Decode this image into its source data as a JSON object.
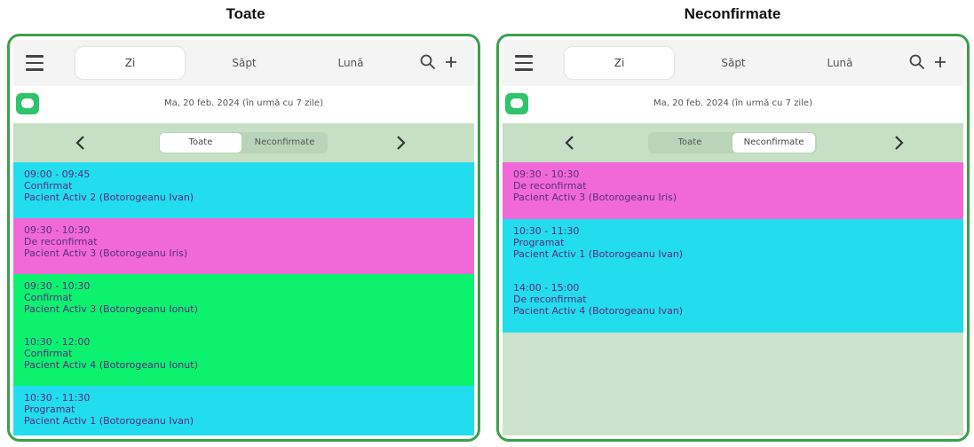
{
  "panels": [
    {
      "caption": "Toate",
      "tabs": {
        "day": "Zi",
        "week": "Săpt",
        "month": "Lună"
      },
      "date": "Ma, 20 feb. 2024 (în urmă cu 7 zile)",
      "filter": {
        "all": "Toate",
        "unconfirmed": "Neconfirmate",
        "selected": "all"
      },
      "appointments": [
        {
          "time": "09:00 - 09:45",
          "status": "Confirmat",
          "patient": "Pacient Activ 2 (Botorogeanu  Ivan)",
          "color": "#22dded"
        },
        {
          "time": "09:30 - 10:30",
          "status": "De reconfirmat",
          "patient": "Pacient Activ 3 (Botorogeanu Iris)",
          "color": "#f169d9"
        },
        {
          "time": "09:30 - 10:30",
          "status": "Confirmat",
          "patient": "Pacient Activ 3 (Botorogeanu Ionut)",
          "color": "#0cf26f"
        },
        {
          "time": "10:30 - 12:00",
          "status": "Confirmat",
          "patient": "Pacient Activ 4 (Botorogeanu Ionut)",
          "color": "#0cf26f"
        },
        {
          "time": "10:30 - 11:30",
          "status": "Programat",
          "patient": "Pacient Activ 1 (Botorogeanu  Ivan)",
          "color": "#22dded"
        }
      ]
    },
    {
      "caption": "Neconfirmate",
      "tabs": {
        "day": "Zi",
        "week": "Săpt",
        "month": "Lună"
      },
      "date": "Ma, 20 feb. 2024 (în urmă cu 7 zile)",
      "filter": {
        "all": "Toate",
        "unconfirmed": "Neconfirmate",
        "selected": "unconfirmed"
      },
      "appointments": [
        {
          "time": "09:30 - 10:30",
          "status": "De reconfirmat",
          "patient": "Pacient Activ 3 (Botorogeanu Iris)",
          "color": "#f169d9"
        },
        {
          "time": "10:30 - 11:30",
          "status": "Programat",
          "patient": "Pacient Activ 1 (Botorogeanu  Ivan)",
          "color": "#22dded"
        },
        {
          "time": "14:00 - 15:00",
          "status": "De reconfirmat",
          "patient": "Pacient Activ 4 (Botorogeanu  Ivan)",
          "color": "#22dded"
        }
      ]
    }
  ],
  "colors": {
    "frame": "#3aa14a",
    "background": "#cde3cb",
    "chat": "#2fc46b"
  },
  "icons": [
    "menu-icon",
    "search-icon",
    "plus-icon",
    "chat-icon",
    "chevron-left-icon",
    "chevron-right-icon"
  ]
}
